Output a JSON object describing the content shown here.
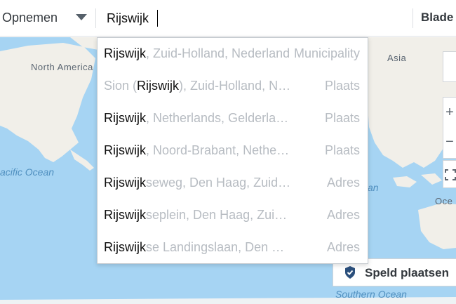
{
  "toolbar": {
    "mode_label": "Opnemen",
    "search_value": "Rijswijk",
    "browse_label": "Blade"
  },
  "map": {
    "labels": {
      "north_america": "North America",
      "asia": "Asia",
      "pacific_ocean": "acific Ocean",
      "southern_ocean": "Southern Ocean",
      "indian_ocean_fragment": "an",
      "oceania_fragment": "Oce"
    },
    "zoom_in_symbol": "+",
    "zoom_out_symbol": "−",
    "pin_button_label": "Speld plaatsen",
    "colors": {
      "water": "#a6d4f3",
      "land": "#f1efe9"
    }
  },
  "suggestions": [
    {
      "prefix": "",
      "match": "Rijswijk",
      "rest": ", Zuid-Holland, Nederland",
      "type": "Municipality",
      "muted": false
    },
    {
      "prefix": "Sion (",
      "match": "Rijswijk",
      "rest": "), Zuid-Holland, N…",
      "type": "Plaats",
      "muted": true
    },
    {
      "prefix": "",
      "match": "Rijswijk",
      "rest": ", Netherlands, Gelderla…",
      "type": "Plaats",
      "muted": false
    },
    {
      "prefix": "",
      "match": "Rijswijk",
      "rest": ", Noord-Brabant, Nethe…",
      "type": "Plaats",
      "muted": false
    },
    {
      "prefix": "",
      "match": "Rijswijk",
      "rest": "seweg, Den Haag, Zuid…",
      "type": "Adres",
      "muted": false
    },
    {
      "prefix": "",
      "match": "Rijswijk",
      "rest": "seplein, Den Haag, Zui…",
      "type": "Adres",
      "muted": false
    },
    {
      "prefix": "",
      "match": "Rijswijk",
      "rest": "se Landingslaan, Den …",
      "type": "Adres",
      "muted": false
    }
  ]
}
